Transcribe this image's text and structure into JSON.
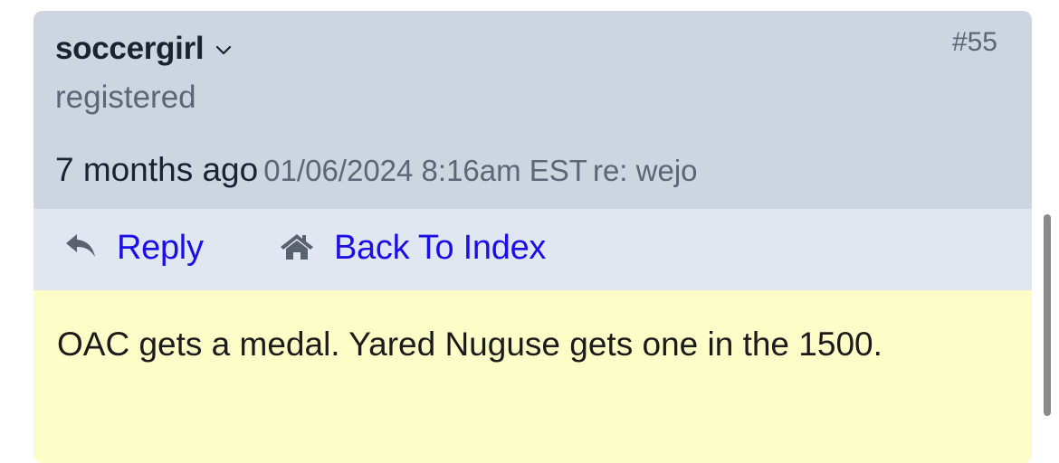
{
  "post": {
    "username": "soccergirl",
    "post_number": "#55",
    "user_status": "registered",
    "time_ago": "7 months ago",
    "timestamp": "01/06/2024 8:16am EST",
    "re": "re: wejo",
    "actions": {
      "reply_label": "Reply",
      "back_label": "Back To Index"
    },
    "message": "OAC gets a medal. Yared Nuguse gets one in the 1500."
  },
  "icons": {
    "username_menu": "chevron-down-icon",
    "reply": "reply-arrow-icon",
    "back": "home-icon"
  },
  "colors": {
    "header_bg": "#ccd5e0",
    "action_bar_bg": "#e1e7f1",
    "body_bg": "#fdfdc8",
    "link": "#1a0fe6"
  }
}
